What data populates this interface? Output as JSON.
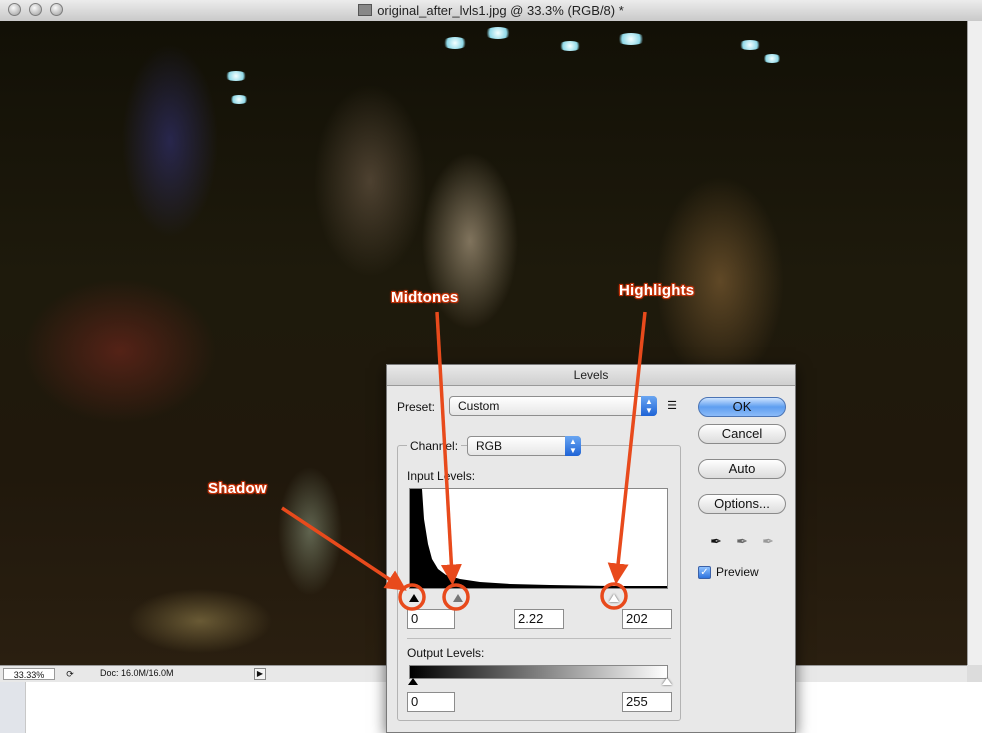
{
  "window": {
    "title": "original_after_lvls1.jpg @ 33.3% (RGB/8) *"
  },
  "status": {
    "zoom": "33.33%",
    "doc_size": "Doc: 16.0M/16.0M"
  },
  "annotations": {
    "shadow": "Shadow",
    "midtones": "Midtones",
    "highlights": "Highlights",
    "color": "#e84a1c"
  },
  "levels_dialog": {
    "title": "Levels",
    "preset_label": "Preset:",
    "preset_value": "Custom",
    "channel_label": "Channel:",
    "channel_value": "RGB",
    "input_levels_label": "Input Levels:",
    "input_shadow": "0",
    "input_gamma": "2.22",
    "input_highlight": "202",
    "output_levels_label": "Output Levels:",
    "output_black": "0",
    "output_white": "255",
    "buttons": {
      "ok": "OK",
      "cancel": "Cancel",
      "auto": "Auto",
      "options": "Options..."
    },
    "preview_label": "Preview",
    "preview_checked": true
  }
}
